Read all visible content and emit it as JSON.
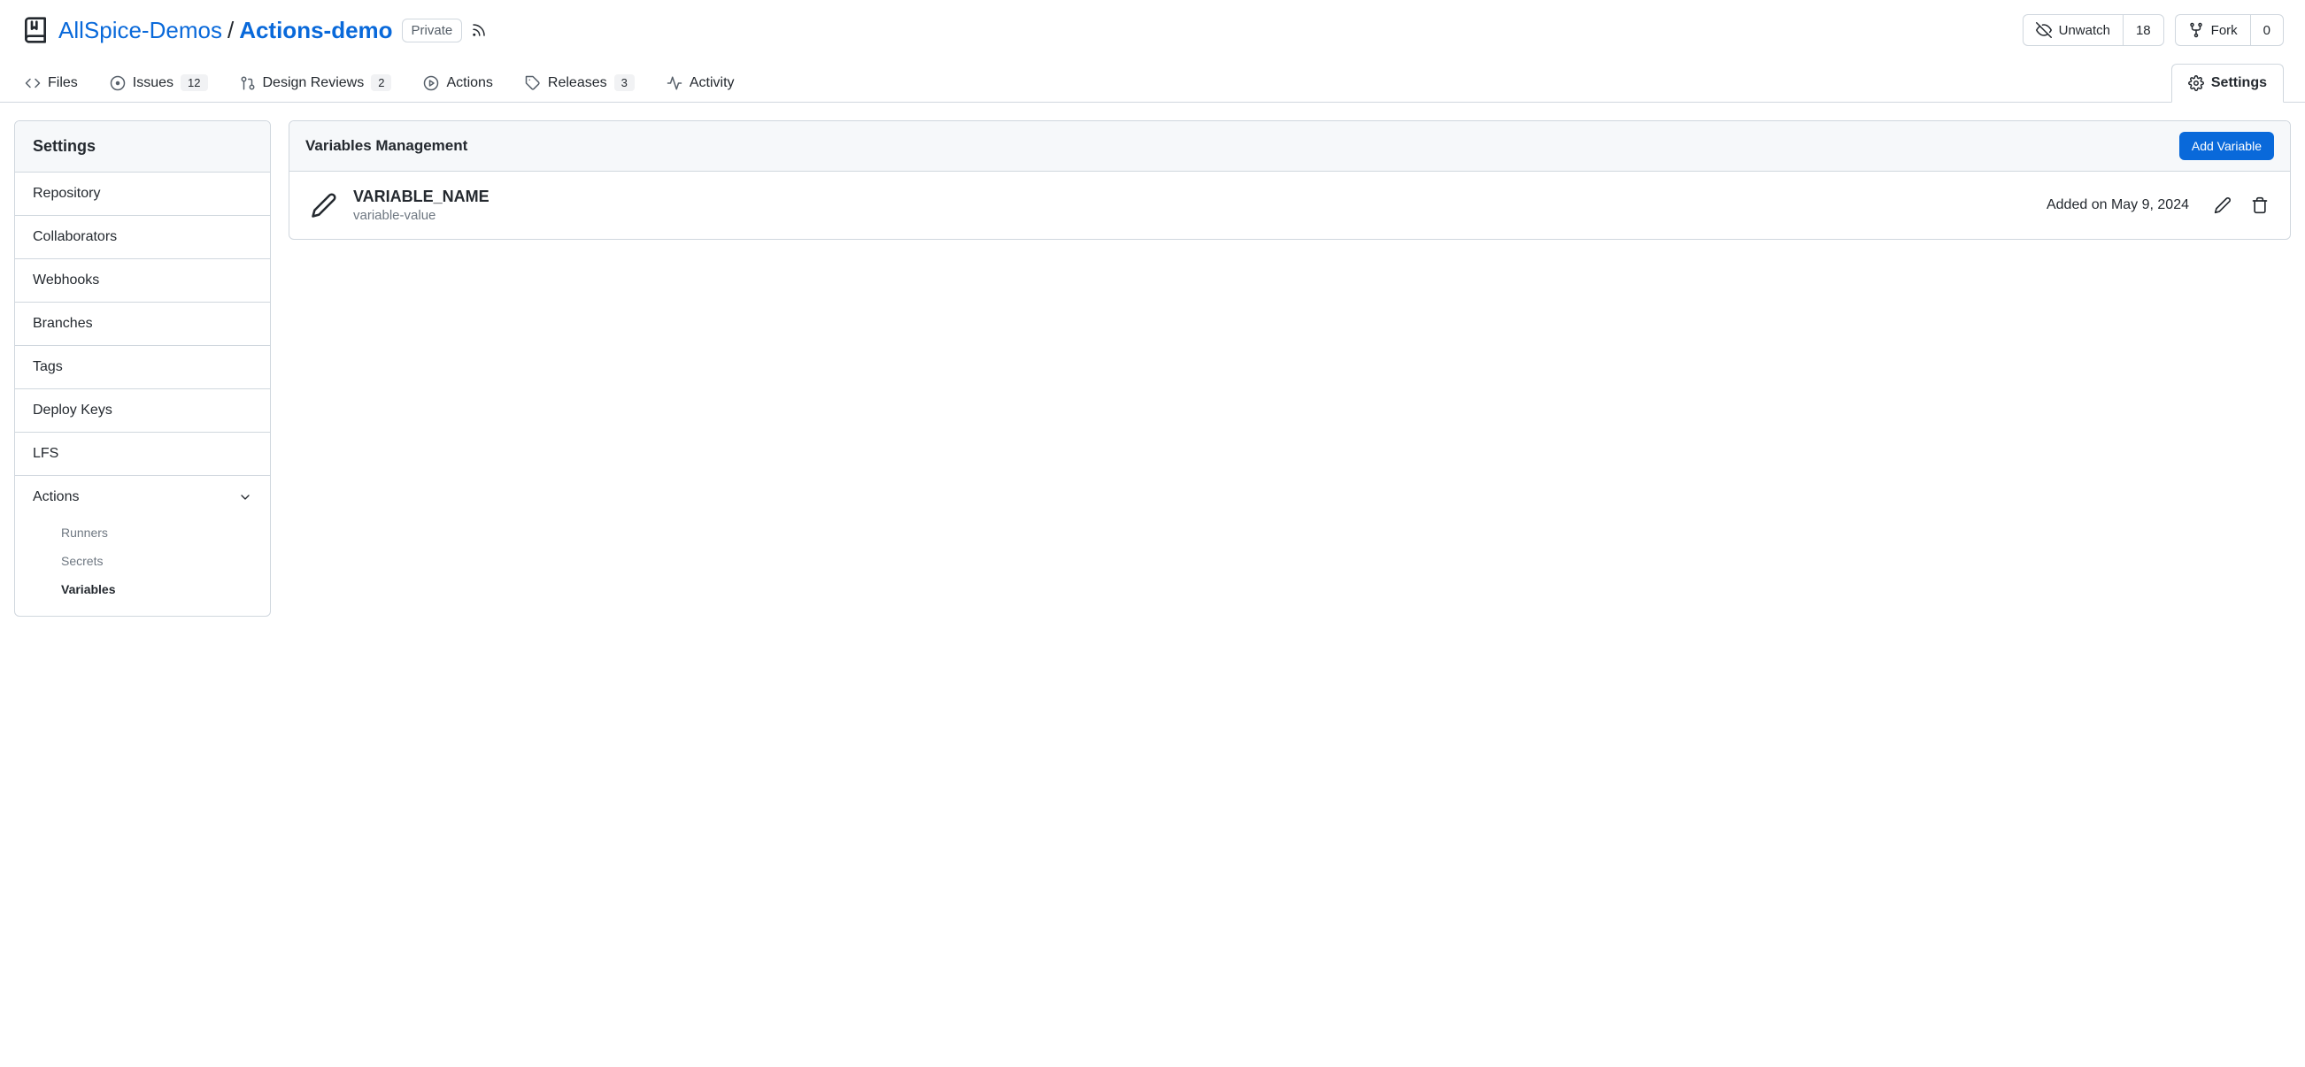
{
  "breadcrumb": {
    "owner": "AllSpice-Demos",
    "separator": "/",
    "repo": "Actions-demo",
    "visibility": "Private"
  },
  "header_actions": {
    "unwatch_label": "Unwatch",
    "watch_count": "18",
    "fork_label": "Fork",
    "fork_count": "0"
  },
  "tabs": {
    "files": "Files",
    "issues": "Issues",
    "issues_count": "12",
    "design_reviews": "Design Reviews",
    "design_reviews_count": "2",
    "actions": "Actions",
    "releases": "Releases",
    "releases_count": "3",
    "activity": "Activity",
    "settings": "Settings"
  },
  "sidebar": {
    "title": "Settings",
    "items": {
      "repository": "Repository",
      "collaborators": "Collaborators",
      "webhooks": "Webhooks",
      "branches": "Branches",
      "tags": "Tags",
      "deploy_keys": "Deploy Keys",
      "lfs": "LFS",
      "actions": "Actions"
    },
    "sub": {
      "runners": "Runners",
      "secrets": "Secrets",
      "variables": "Variables"
    }
  },
  "panel": {
    "title": "Variables Management",
    "add_button": "Add Variable",
    "variable": {
      "name": "VARIABLE_NAME",
      "value": "variable-value",
      "added": "Added on May 9, 2024"
    }
  }
}
